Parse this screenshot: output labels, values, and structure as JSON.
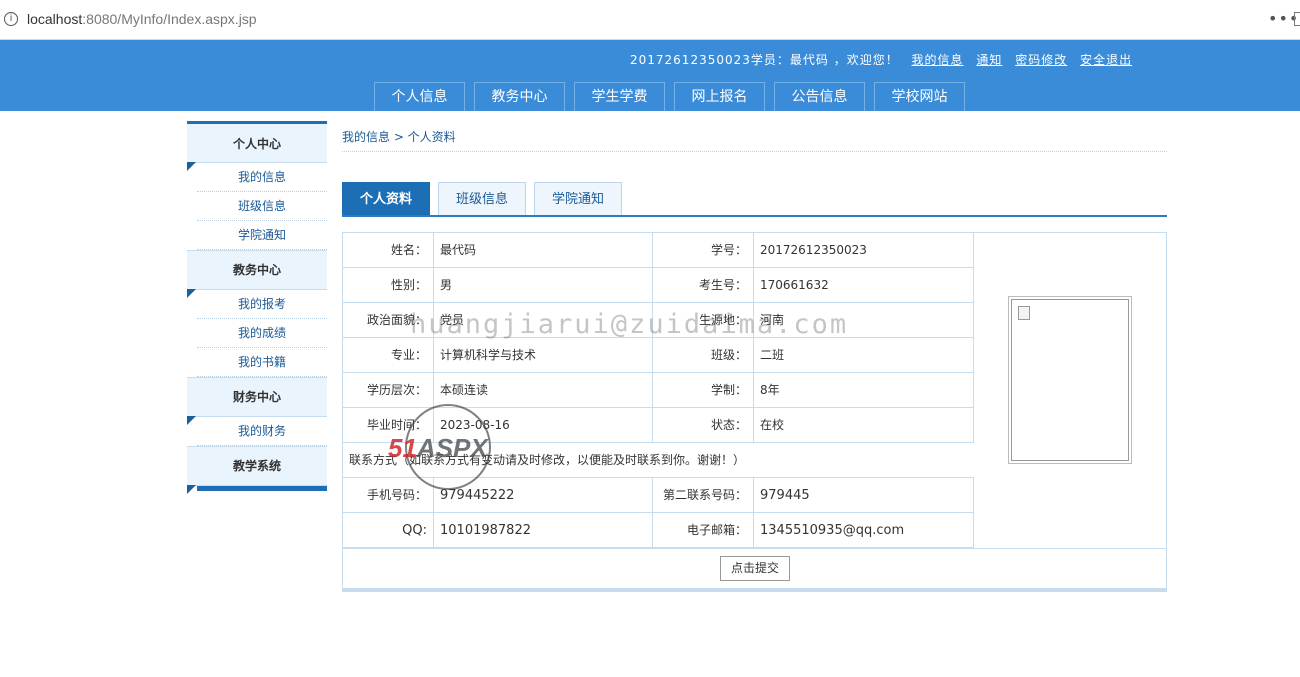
{
  "browser": {
    "url_host": "localhost",
    "url_rest": ":8080/MyInfo/Index.aspx.jsp",
    "more": "•••"
  },
  "header": {
    "user_text": "20172612350023学员：最代码 ，欢迎您！",
    "links": [
      "我的信息",
      "通知",
      "密码修改",
      "安全退出"
    ],
    "nav": [
      "个人信息",
      "教务中心",
      "学生学费",
      "网上报名",
      "公告信息",
      "学校网站"
    ]
  },
  "sidebar": {
    "sections": [
      {
        "title": "个人中心",
        "items": [
          "我的信息",
          "班级信息",
          "学院通知"
        ]
      },
      {
        "title": "教务中心",
        "items": [
          "我的报考",
          "我的成绩",
          "我的书籍"
        ]
      },
      {
        "title": "财务中心",
        "items": [
          "我的财务"
        ]
      },
      {
        "title": "教学系统",
        "items": []
      }
    ]
  },
  "breadcrumb": "我的信息 > 个人资料",
  "tabs": [
    "个人资料",
    "班级信息",
    "学院通知"
  ],
  "profile": {
    "name_label": "姓名：",
    "name": "最代码",
    "id_label": "学号：",
    "id": "20172612350023",
    "gender_label": "性别：",
    "gender": "男",
    "exam_label": "考生号：",
    "exam": "170661632",
    "party_label": "政治面貌：",
    "party": "党员",
    "origin_label": "生源地：",
    "origin": "河南",
    "major_label": "专业：",
    "major": "计算机科学与技术",
    "class_label": "班级：",
    "class": "二班",
    "level_label": "学历层次：",
    "level": "本硕连读",
    "years_label": "学制：",
    "years": "8年",
    "grad_label": "毕业时间：",
    "grad": "2023-08-16",
    "status_label": "状态：",
    "status": "在校",
    "contact_note": "联系方式（如联系方式有变动请及时修改，以便能及时联系到你。谢谢！）",
    "phone_label": "手机号码：",
    "phone": "979445222",
    "phone2_label": "第二联系号码：",
    "phone2": "979445",
    "qq_label": "QQ:",
    "qq": "10101987822",
    "email_label": "电子邮箱：",
    "email": "1345510935@qq.com",
    "submit": "点击提交"
  },
  "watermark": {
    "text": "huangjiarui@zuidaima.com",
    "logo_a": "51",
    "logo_b": "ASPX"
  }
}
